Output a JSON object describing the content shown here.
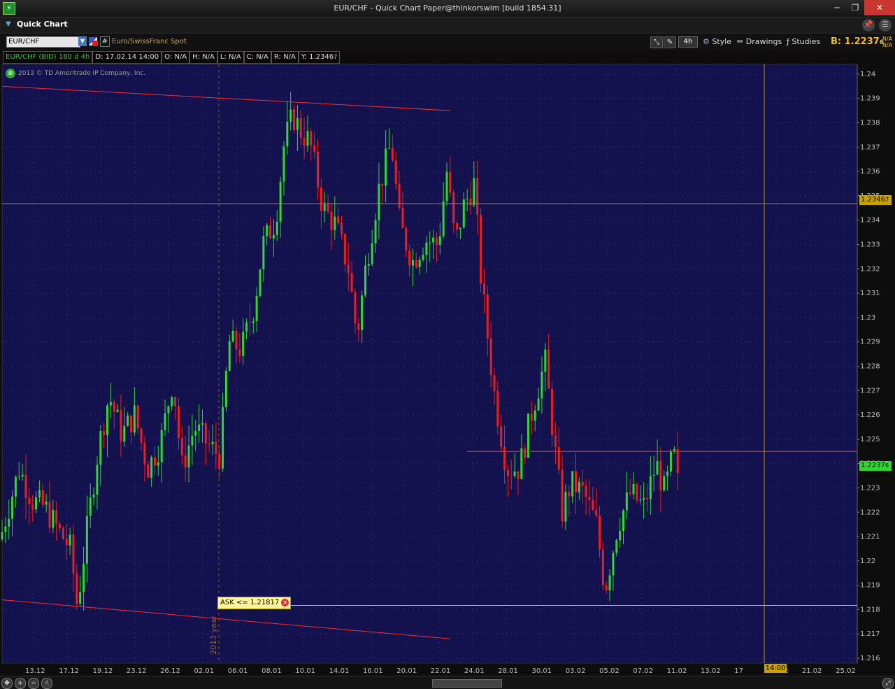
{
  "window": {
    "title": "EUR/CHF - Quick Chart Paper@thinkorswim [build 1854.31]",
    "minimize": "─",
    "maximize": "❐",
    "close": "✕"
  },
  "panel": {
    "title": "Quick Chart"
  },
  "toolbar": {
    "symbol": "EUR/CHF",
    "description": "Euro/SwissFranc Spot",
    "aggregation": "4h",
    "style_label": "Style",
    "drawings_label": "Drawings",
    "studies_label": "Studies",
    "bid_label": "B: 1.2237",
    "bid_small": "6",
    "na_top": "N/A",
    "na_bottom": "N/A"
  },
  "info": {
    "symbol_period": "EUR/CHF (BID) 180 d 4h",
    "date": "D: 17.02.14 14:00",
    "open": "O: N/A",
    "high": "H: N/A",
    "low": "L: N/A",
    "close": "C: N/A",
    "range": "R: N/A",
    "y": "Y: 1.2346",
    "y_small": "7"
  },
  "copyright": "2013 © TD Ameritrade IP Company, Inc.",
  "year_marker": "2013 year",
  "ask_alert": "ASK <= 1.21817",
  "price_tags": {
    "cursor": "1.2346",
    "cursor_small": "7",
    "last": "1.2237",
    "last_small": "6"
  },
  "time_tag": "14:00",
  "colors": {
    "chart_bg": "#14124e",
    "up": "#2fd72f",
    "down": "#ee1c1c",
    "trendline": "#ff2a2a",
    "crosshair": "#c0901a",
    "alert_line": "#d6c12a",
    "axis_text": "#bbbbbb"
  },
  "chart_data": {
    "type": "candlestick",
    "ylim": [
      1.2158,
      1.2404
    ],
    "y_ticks": [
      "1.24",
      "1.239",
      "1.238",
      "1.237",
      "1.236",
      "1.235",
      "1.234",
      "1.233",
      "1.232",
      "1.231",
      "1.23",
      "1.229",
      "1.228",
      "1.227",
      "1.226",
      "1.225",
      "1.224",
      "1.223",
      "1.222",
      "1.221",
      "1.22",
      "1.219",
      "1.218",
      "1.217",
      "1.216"
    ],
    "x_ticks": [
      "13.12",
      "17.12",
      "19.12",
      "23.12",
      "26.12",
      "02.01",
      "06.01",
      "08.01",
      "10.01",
      "14.01",
      "16.01",
      "20.01",
      "22.01",
      "24.01",
      "28.01",
      "30.01",
      "03.02",
      "05.02",
      "07.02",
      "11.02",
      "13.02",
      "17",
      "19.02",
      "21.02",
      "25.02"
    ],
    "cursor_price": 1.23467,
    "last_price": 1.22376,
    "ask_alert_price": 1.21817,
    "resistance_price": 1.2245,
    "x_domain": [
      0,
      1.0
    ],
    "path": [
      [
        0.0,
        1.2212
      ],
      [
        0.02,
        1.2238
      ],
      [
        0.035,
        1.2225
      ],
      [
        0.05,
        1.2222
      ],
      [
        0.065,
        1.2213
      ],
      [
        0.08,
        1.2205
      ],
      [
        0.088,
        1.2181
      ],
      [
        0.1,
        1.2215
      ],
      [
        0.112,
        1.2245
      ],
      [
        0.125,
        1.2268
      ],
      [
        0.14,
        1.2252
      ],
      [
        0.155,
        1.226
      ],
      [
        0.17,
        1.2238
      ],
      [
        0.185,
        1.2248
      ],
      [
        0.2,
        1.2275
      ],
      [
        0.21,
        1.2238
      ],
      [
        0.225,
        1.2255
      ],
      [
        0.24,
        1.2248
      ],
      [
        0.255,
        1.2243
      ],
      [
        0.265,
        1.229
      ],
      [
        0.28,
        1.2287
      ],
      [
        0.295,
        1.2305
      ],
      [
        0.305,
        1.233
      ],
      [
        0.32,
        1.234
      ],
      [
        0.33,
        1.2372
      ],
      [
        0.34,
        1.2383
      ],
      [
        0.35,
        1.2376
      ],
      [
        0.36,
        1.2372
      ],
      [
        0.375,
        1.2345
      ],
      [
        0.39,
        1.2338
      ],
      [
        0.405,
        1.232
      ],
      [
        0.415,
        1.2292
      ],
      [
        0.425,
        1.232
      ],
      [
        0.44,
        1.2352
      ],
      [
        0.455,
        1.2372
      ],
      [
        0.465,
        1.2338
      ],
      [
        0.48,
        1.2323
      ],
      [
        0.495,
        1.2332
      ],
      [
        0.51,
        1.233
      ],
      [
        0.52,
        1.236
      ],
      [
        0.53,
        1.233
      ],
      [
        0.54,
        1.2346
      ],
      [
        0.552,
        1.2355
      ],
      [
        0.56,
        1.2316
      ],
      [
        0.575,
        1.227
      ],
      [
        0.59,
        1.2238
      ],
      [
        0.605,
        1.2238
      ],
      [
        0.62,
        1.2262
      ],
      [
        0.635,
        1.2282
      ],
      [
        0.645,
        1.225
      ],
      [
        0.655,
        1.222
      ],
      [
        0.665,
        1.2232
      ],
      [
        0.68,
        1.2228
      ],
      [
        0.695,
        1.2215
      ],
      [
        0.705,
        1.2188
      ],
      [
        0.72,
        1.2215
      ],
      [
        0.735,
        1.2228
      ],
      [
        0.75,
        1.2222
      ],
      [
        0.765,
        1.224
      ],
      [
        0.775,
        1.2228
      ],
      [
        0.785,
        1.2245
      ],
      [
        0.79,
        1.2232
      ]
    ],
    "trendlines": [
      {
        "from": [
          0.0,
          1.2395
        ],
        "to": [
          0.524,
          1.2385
        ]
      },
      {
        "from": [
          0.0,
          1.2184
        ],
        "to": [
          0.524,
          1.2168
        ]
      }
    ]
  }
}
